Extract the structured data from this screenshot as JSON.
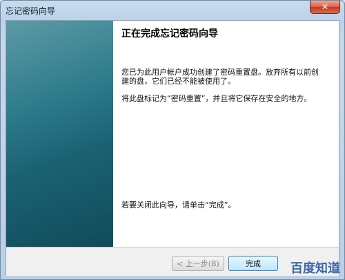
{
  "window": {
    "title": "忘记密码向导",
    "close_glyph": "✕"
  },
  "content": {
    "heading": "正在完成忘记密码向导",
    "paragraph1": "您已为此用户帐户成功创建了密码重置盘。放弃所有以前创建的盘，它们已经不能被使用了。",
    "paragraph2": "将此盘标记为“密码重置”，并且将它保存在安全的地方。",
    "paragraph3": "若要关闭此向导，请单击“完成”。"
  },
  "buttons": {
    "back_label": "< 上一步(B)",
    "finish_label": "完成"
  },
  "watermark": {
    "text": "百度知道"
  },
  "colors": {
    "side_panel": "#1a6273",
    "close_button": "#c13b22"
  }
}
